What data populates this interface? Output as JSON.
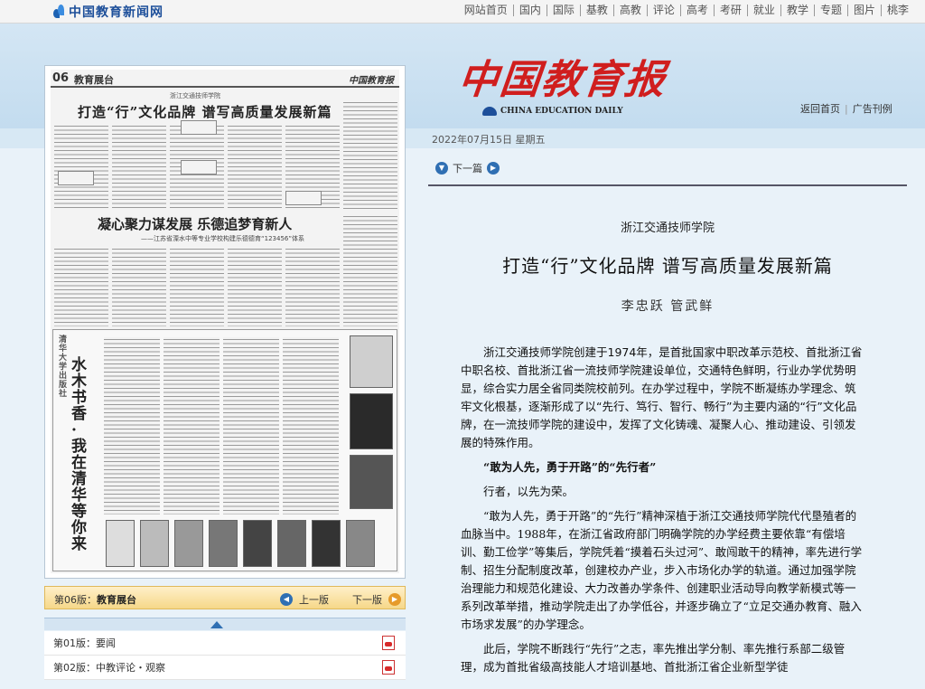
{
  "site": {
    "logo_text": "中国教育新闻网"
  },
  "nav": [
    "网站首页",
    "国内",
    "国际",
    "基教",
    "高教",
    "评论",
    "高考",
    "考研",
    "就业",
    "教学",
    "专题",
    "图片",
    "桃李"
  ],
  "masthead": {
    "cn": "中国教育报",
    "en": "CHINA EDUCATION DAILY"
  },
  "header_links": {
    "home": "返回首页",
    "ads": "广告刊例"
  },
  "date": "2022年07月15日 星期五",
  "paper": {
    "page_no": "06",
    "section": "教育展台",
    "logo": "中国教育报",
    "kicker": "浙江交通技师学院",
    "headline": "打造“行”文化品牌 谱写高质量发展新篇",
    "headline2": "凝心聚力谋发展 乐德追梦育新人",
    "headline2_sub": "——江苏省溧水中等专业学校构建乐德德育“123456”体系",
    "ad_title": "水木书香·我在清华等你来",
    "ad_logo": "清华大学出版社"
  },
  "pagebar": {
    "label": "第06版：",
    "name": "教育展台",
    "prev": "上一版",
    "next": "下一版"
  },
  "pages": [
    {
      "label": "第01版：",
      "name": "要闻"
    },
    {
      "label": "第02版：",
      "name": "中教评论・观察"
    }
  ],
  "article": {
    "next": "下一篇",
    "kicker": "浙江交通技师学院",
    "title": "打造“行”文化品牌 谱写高质量发展新篇",
    "author": "李忠跃 管武鲜",
    "paragraphs": [
      "浙江交通技师学院创建于1974年，是首批国家中职改革示范校、首批浙江省中职名校、首批浙江省一流技师学院建设单位，交通特色鲜明，行业办学优势明显，综合实力居全省同类院校前列。在办学过程中，学院不断凝练办学理念、筑牢文化根基，逐渐形成了以“先行、笃行、智行、畅行”为主要内涵的“行”文化品牌，在一流技师学院的建设中，发挥了文化铸魂、凝聚人心、推动建设、引领发展的特殊作用。",
      "“敢为人先，勇于开路”的“先行者”",
      "行者，以先为荣。",
      "“敢为人先，勇于开路”的“先行”精神深植于浙江交通技师学院代代垦殖者的血脉当中。1988年，在浙江省政府部门明确学院的办学经费主要依靠“有偿培训、勤工俭学”等集后，学院凭着“摸着石头过河”、敢闯敢干的精神，率先进行学制、招生分配制度改革，创建校办产业，步入市场化办学的轨道。通过加强学院治理能力和规范化建设、大力改善办学条件、创建职业活动导向教学新模式等一系列改革举措，推动学院走出了办学低谷，并逐步确立了“立足交通办教育、融入市场求发展”的办学理念。",
      "此后，学院不断践行“先行”之志，率先推出学分制、率先推行系部二级管理，成为首批省级高技能人才培训基地、首批浙江省企业新型学徒"
    ]
  }
}
